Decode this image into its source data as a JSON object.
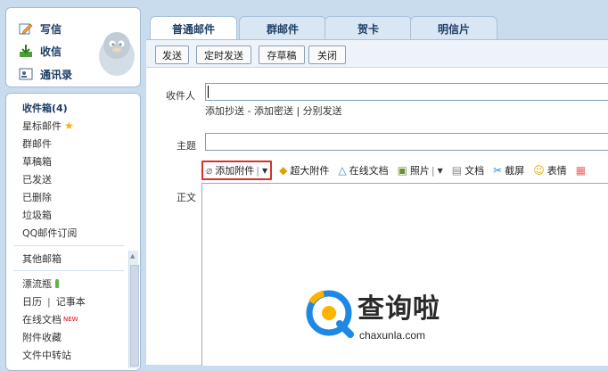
{
  "sidebar": {
    "compose": "写信",
    "inbox": "收信",
    "contacts": "通讯录",
    "folders": [
      {
        "label": "收件箱(4)"
      },
      {
        "label": "星标邮件"
      },
      {
        "label": "群邮件"
      },
      {
        "label": "草稿箱"
      },
      {
        "label": "已发送"
      },
      {
        "label": "已删除"
      },
      {
        "label": "垃圾箱"
      },
      {
        "label": "QQ邮件订阅"
      }
    ],
    "other_mailboxes": "其他邮箱",
    "apps": [
      {
        "label": "漂流瓶"
      },
      {
        "label": "日历"
      },
      {
        "label": "记事本"
      },
      {
        "label": "在线文档"
      },
      {
        "label": "附件收藏"
      },
      {
        "label": "文件中转站"
      }
    ],
    "new_badge": "NEW",
    "divider": "|"
  },
  "tabs": [
    "普通邮件",
    "群邮件",
    "贺卡",
    "明信片"
  ],
  "toolbar": {
    "send": "发送",
    "timed_send": "定时发送",
    "save_draft": "存草稿",
    "close": "关闭"
  },
  "form": {
    "to_label": "收件人",
    "add_cc": "添加抄送",
    "dash": " - ",
    "add_bcc": "添加密送",
    "bar": " | ",
    "separate_send": "分别发送",
    "subject_label": "主题",
    "body_label": "正文"
  },
  "attach_bar": {
    "add_attachment": "添加附件",
    "large_attachment": "超大附件",
    "online_doc": "在线文档",
    "photo": "照片",
    "document": "文档",
    "screenshot": "截屏",
    "emoji": "表情"
  },
  "watermark": {
    "brand": "查询啦",
    "url": "chaxunla.com"
  },
  "colors": {
    "accent": "#1c3b63",
    "highlight_box": "#d9302c",
    "background": "#c9dcee"
  }
}
